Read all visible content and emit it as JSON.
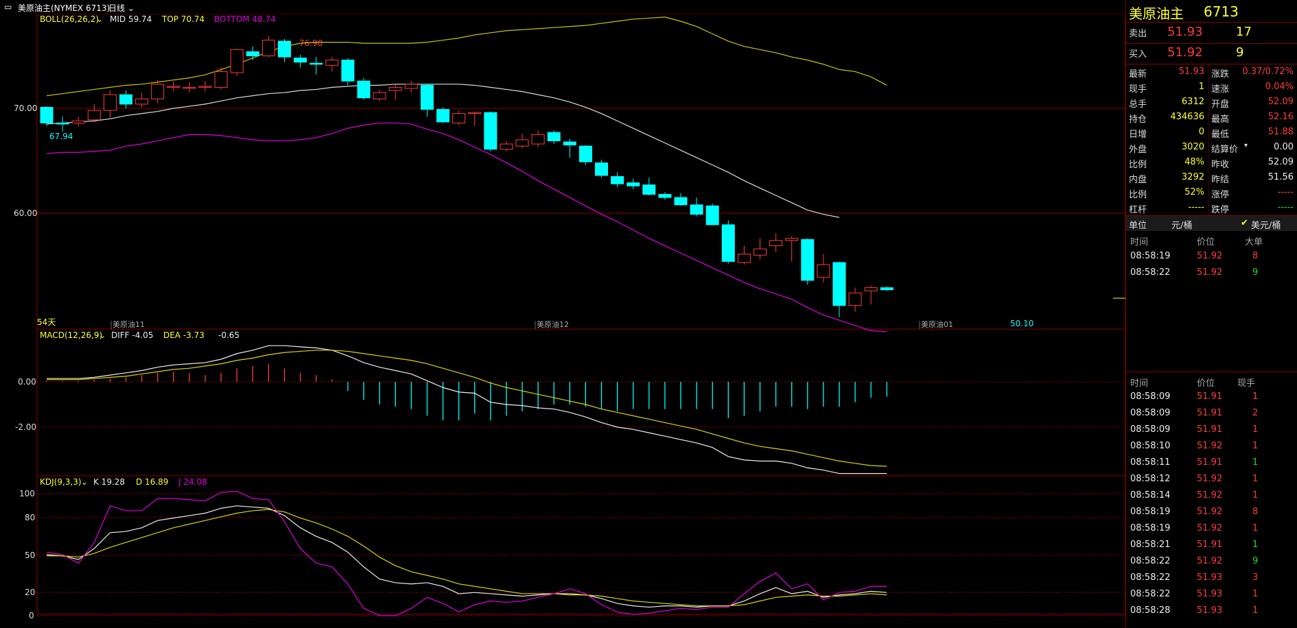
{
  "header": {
    "window_icon": "minimize-icon",
    "symbol_title": "美原油主(NYMEX 6713)",
    "period": "日线"
  },
  "indicators": {
    "boll": {
      "label": "BOLL(26,26,2)",
      "mid": "MID 59.74",
      "top": "TOP 70.74",
      "bottom": "BOTTOM 48.74"
    },
    "macd": {
      "label": "MACD(12,26,9)",
      "diff": "DIFF -4.05",
      "dea": "DEA -3.73",
      "macd": "-0.65"
    },
    "kdj": {
      "label": "KDJ(9,3,3)",
      "k": "K 19.28",
      "d": "D 16.89",
      "j": "J 24.08"
    }
  },
  "price_panel": {
    "y_ticks": [
      "70.00",
      "60.00"
    ],
    "high_label": "76.90",
    "low_label": "67.94",
    "last_low_label": "50.10",
    "days_label": "54天",
    "contract_labels": [
      "美原油11",
      "美原油12",
      "美原油01"
    ]
  },
  "macd_panel": {
    "y_ticks": [
      "0.00",
      "-2.00"
    ]
  },
  "kdj_panel": {
    "y_ticks": [
      "100",
      "80",
      "50",
      "20",
      "0"
    ]
  },
  "chart_data": {
    "type": "candlestick",
    "price_ylim": [
      48.0,
      80.0
    ],
    "candles": [
      [
        70.1,
        68.6,
        70.2,
        68.3
      ],
      [
        68.6,
        68.5,
        69.2,
        67.8
      ],
      [
        68.6,
        68.8,
        69.2,
        68.3
      ],
      [
        68.9,
        69.8,
        70.4,
        68.7
      ],
      [
        69.8,
        71.3,
        71.7,
        69.1
      ],
      [
        71.3,
        70.4,
        71.7,
        70.0
      ],
      [
        70.4,
        70.9,
        71.5,
        70.1
      ],
      [
        70.9,
        72.3,
        72.7,
        70.5
      ],
      [
        72.1,
        72.1,
        72.6,
        71.6
      ],
      [
        72.0,
        72.0,
        72.5,
        71.5
      ],
      [
        72.0,
        72.1,
        72.6,
        71.6
      ],
      [
        72.0,
        73.5,
        73.9,
        71.8
      ],
      [
        73.4,
        75.6,
        75.7,
        73.1
      ],
      [
        75.4,
        75.0,
        75.9,
        74.6
      ],
      [
        75.0,
        76.5,
        76.9,
        74.9
      ],
      [
        76.4,
        74.9,
        76.6,
        74.4
      ],
      [
        74.8,
        74.4,
        75.1,
        73.9
      ],
      [
        74.3,
        74.2,
        74.9,
        73.2
      ],
      [
        74.1,
        74.6,
        74.9,
        73.5
      ],
      [
        74.6,
        72.6,
        74.8,
        72.2
      ],
      [
        72.6,
        71.0,
        72.9,
        70.8
      ],
      [
        70.9,
        71.5,
        71.8,
        70.7
      ],
      [
        71.7,
        72.0,
        72.3,
        70.8
      ],
      [
        71.9,
        72.3,
        72.6,
        71.5
      ],
      [
        72.2,
        69.9,
        72.3,
        69.2
      ],
      [
        69.9,
        68.7,
        70.1,
        68.6
      ],
      [
        68.6,
        69.5,
        69.8,
        68.4
      ],
      [
        69.5,
        69.6,
        69.7,
        68.3
      ],
      [
        69.6,
        66.1,
        69.7,
        65.9
      ],
      [
        66.1,
        66.6,
        66.9,
        65.9
      ],
      [
        66.4,
        67.0,
        67.6,
        66.2
      ],
      [
        66.6,
        67.5,
        67.9,
        66.3
      ],
      [
        67.7,
        66.9,
        67.9,
        66.6
      ],
      [
        66.8,
        66.5,
        67.1,
        65.3
      ],
      [
        66.4,
        64.9,
        66.5,
        64.6
      ],
      [
        64.8,
        63.6,
        65.1,
        63.4
      ],
      [
        63.5,
        62.8,
        63.9,
        62.5
      ],
      [
        62.9,
        62.6,
        63.3,
        62.3
      ],
      [
        62.7,
        61.8,
        63.4,
        61.7
      ],
      [
        61.8,
        61.5,
        62.0,
        61.3
      ],
      [
        61.5,
        60.8,
        61.9,
        60.7
      ],
      [
        60.8,
        59.9,
        61.5,
        59.7
      ],
      [
        60.7,
        58.9,
        60.9,
        58.9
      ],
      [
        58.9,
        55.4,
        59.3,
        55.2
      ],
      [
        55.3,
        56.1,
        56.9,
        55.1
      ],
      [
        56.0,
        56.6,
        57.6,
        55.6
      ],
      [
        56.9,
        57.4,
        58.1,
        56.3
      ],
      [
        57.4,
        57.6,
        57.8,
        55.4
      ],
      [
        57.5,
        53.6,
        57.6,
        53.2
      ],
      [
        53.9,
        55.1,
        56.1,
        53.4
      ],
      [
        55.3,
        51.2,
        55.4,
        50.1
      ],
      [
        51.2,
        52.4,
        52.9,
        50.6
      ],
      [
        52.6,
        52.9,
        53.1,
        51.3
      ],
      [
        52.9,
        52.7,
        53.0,
        52.6
      ]
    ],
    "boll_top": [
      71.2,
      71.4,
      71.6,
      71.8,
      72.0,
      72.2,
      72.3,
      72.5,
      72.7,
      72.9,
      73.2,
      73.7,
      74.2,
      74.8,
      75.4,
      75.9,
      76.2,
      76.3,
      76.3,
      76.3,
      76.2,
      76.2,
      76.2,
      76.2,
      76.3,
      76.5,
      76.7,
      77.0,
      77.2,
      77.4,
      77.5,
      77.6,
      77.7,
      77.8,
      77.9,
      78.1,
      78.3,
      78.5,
      78.6,
      78.7,
      78.3,
      77.8,
      77.1,
      76.4,
      75.9,
      75.6,
      75.3,
      74.9,
      74.6,
      74.2,
      73.7,
      73.5,
      73.0,
      72.2
    ],
    "boll_mid": [
      68.5,
      68.6,
      68.7,
      68.8,
      69.0,
      69.3,
      69.5,
      69.7,
      70.0,
      70.2,
      70.4,
      70.7,
      71.0,
      71.2,
      71.4,
      71.5,
      71.7,
      71.8,
      72.0,
      72.1,
      72.2,
      72.2,
      72.3,
      72.3,
      72.3,
      72.3,
      72.3,
      72.2,
      72.0,
      71.8,
      71.6,
      71.3,
      71.0,
      70.6,
      70.1,
      69.5,
      68.8,
      68.1,
      67.4,
      66.7,
      66.0,
      65.3,
      64.6,
      63.9,
      63.1,
      62.4,
      61.7,
      61.0,
      60.3,
      59.9,
      59.6
    ],
    "boll_bot": [
      65.7,
      65.8,
      65.8,
      65.9,
      66.0,
      66.4,
      66.6,
      66.9,
      67.2,
      67.5,
      67.5,
      67.4,
      67.2,
      67.0,
      66.9,
      66.9,
      67.0,
      67.2,
      67.6,
      68.1,
      68.4,
      68.6,
      68.6,
      68.5,
      68.0,
      67.6,
      67.0,
      66.3,
      65.6,
      64.8,
      64.0,
      63.1,
      62.3,
      61.5,
      60.7,
      59.9,
      59.2,
      58.4,
      57.6,
      56.9,
      56.2,
      55.5,
      54.8,
      54.1,
      53.4,
      52.8,
      52.3,
      51.8,
      51.0,
      50.3,
      49.8,
      49.3,
      48.8,
      48.7
    ],
    "macd_ylim": [
      -4.3,
      1.8
    ],
    "macd_diff": [
      0.15,
      0.15,
      0.15,
      0.2,
      0.3,
      0.4,
      0.5,
      0.65,
      0.75,
      0.8,
      0.85,
      1.0,
      1.25,
      1.4,
      1.6,
      1.6,
      1.55,
      1.5,
      1.4,
      1.15,
      0.85,
      0.65,
      0.5,
      0.35,
      0.05,
      -0.25,
      -0.45,
      -0.5,
      -0.9,
      -1.0,
      -1.05,
      -1.15,
      -1.2,
      -1.35,
      -1.55,
      -1.8,
      -2.0,
      -2.1,
      -2.25,
      -2.4,
      -2.55,
      -2.7,
      -2.9,
      -3.3,
      -3.45,
      -3.5,
      -3.5,
      -3.6,
      -3.8,
      -3.9,
      -4.05,
      -4.05,
      -4.05,
      -4.05
    ],
    "macd_dea": [
      0.1,
      0.1,
      0.1,
      0.15,
      0.2,
      0.25,
      0.35,
      0.45,
      0.55,
      0.6,
      0.7,
      0.8,
      0.95,
      1.05,
      1.2,
      1.3,
      1.35,
      1.4,
      1.4,
      1.35,
      1.25,
      1.15,
      1.05,
      0.95,
      0.8,
      0.6,
      0.4,
      0.2,
      -0.05,
      -0.25,
      -0.4,
      -0.55,
      -0.7,
      -0.85,
      -1.0,
      -1.2,
      -1.35,
      -1.5,
      -1.65,
      -1.8,
      -1.95,
      -2.1,
      -2.3,
      -2.5,
      -2.7,
      -2.85,
      -2.95,
      -3.05,
      -3.2,
      -3.35,
      -3.5,
      -3.6,
      -3.7,
      -3.73
    ],
    "macd_hist": [
      0.05,
      0.05,
      0.05,
      0.1,
      0.15,
      0.2,
      0.3,
      0.4,
      0.45,
      0.4,
      0.3,
      0.4,
      0.6,
      0.7,
      0.8,
      0.6,
      0.4,
      0.3,
      0.1,
      -0.4,
      -0.8,
      -1.0,
      -1.1,
      -1.2,
      -1.5,
      -1.7,
      -1.7,
      -1.4,
      -1.7,
      -1.5,
      -1.3,
      -1.2,
      -1.0,
      -1.0,
      -1.1,
      -1.2,
      -1.3,
      -1.2,
      -1.2,
      -1.2,
      -1.2,
      -1.2,
      -1.2,
      -1.6,
      -1.5,
      -1.3,
      -1.1,
      -1.1,
      -1.2,
      -1.1,
      -1.1,
      -0.9,
      -0.7,
      -0.65
    ],
    "kdj_ylim": [
      -5,
      105
    ],
    "kdj_k": [
      50,
      49,
      46,
      55,
      68,
      69,
      72,
      78,
      80,
      82,
      84,
      88,
      90,
      89,
      88,
      82,
      72,
      65,
      60,
      52,
      40,
      30,
      27,
      26,
      27,
      24,
      18,
      19,
      18,
      17,
      16,
      17,
      18,
      18,
      17,
      14,
      10,
      8,
      7,
      8,
      8,
      7,
      8,
      8,
      12,
      18,
      23,
      18,
      20,
      15,
      17,
      18,
      20,
      19
    ],
    "kdj_d": [
      49,
      49,
      48,
      51,
      56,
      60,
      64,
      68,
      72,
      75,
      78,
      81,
      84,
      86,
      87,
      85,
      80,
      76,
      71,
      65,
      57,
      48,
      41,
      36,
      33,
      30,
      26,
      24,
      22,
      20,
      18,
      18,
      18,
      17,
      17,
      16,
      14,
      12,
      11,
      10,
      9,
      8,
      8,
      8,
      9,
      12,
      15,
      16,
      17,
      16,
      16,
      17,
      18,
      17
    ],
    "kdj_j": [
      52,
      50,
      43,
      60,
      90,
      86,
      86,
      96,
      96,
      95,
      94,
      101,
      102,
      96,
      95,
      77,
      55,
      43,
      40,
      26,
      6,
      0,
      0,
      6,
      15,
      10,
      3,
      9,
      12,
      11,
      12,
      15,
      18,
      22,
      18,
      9,
      3,
      1,
      2,
      4,
      6,
      5,
      7,
      7,
      18,
      28,
      35,
      22,
      26,
      13,
      19,
      20,
      24,
      24
    ]
  },
  "right_panel": {
    "title": "美原油主",
    "code": "6713",
    "sell_label": "卖出",
    "sell_price": "51.93",
    "sell_vol": "17",
    "buy_label": "买入",
    "buy_price": "51.92",
    "buy_vol": "9",
    "stats": [
      {
        "l1": "最新",
        "v1": "51.93",
        "c1": "red",
        "l2": "涨跌",
        "v2": "0.37/0.72%",
        "c2": "red"
      },
      {
        "l1": "现手",
        "v1": "1",
        "c1": "yellow",
        "l2": "速涨",
        "v2": "0.04%",
        "c2": "red"
      },
      {
        "l1": "总手",
        "v1": "6312",
        "c1": "yellow",
        "l2": "开盘",
        "v2": "52.09",
        "c2": "red"
      },
      {
        "l1": "持仓",
        "v1": "434636",
        "c1": "yellow",
        "l2": "最高",
        "v2": "52.16",
        "c2": "red"
      },
      {
        "l1": "日增",
        "v1": "0",
        "c1": "yellow",
        "l2": "最低",
        "v2": "51.88",
        "c2": "red"
      },
      {
        "l1": "外盘",
        "v1": "3020",
        "c1": "yellow",
        "l2": "结算价",
        "v2": "0.00",
        "c2": "white"
      },
      {
        "l1": "比例",
        "v1": "48%",
        "c1": "yellow",
        "l2": "昨收",
        "v2": "52.09",
        "c2": "white"
      },
      {
        "l1": "内盘",
        "v1": "3292",
        "c1": "yellow",
        "l2": "昨结",
        "v2": "51.56",
        "c2": "white"
      },
      {
        "l1": "比例",
        "v1": "52%",
        "c1": "yellow",
        "l2": "涨停",
        "v2": "-----",
        "c2": "red"
      },
      {
        "l1": "杠杆",
        "v1": "-----",
        "c1": "yellow",
        "l2": "跌停",
        "v2": "-----",
        "c2": "green"
      }
    ],
    "unit_label": "单位",
    "unit_cny": "元/桶",
    "unit_usd": "美元/桶",
    "bigorder_headers": [
      "时间",
      "价位",
      "大单"
    ],
    "bigorders": [
      {
        "t": "08:58:19",
        "p": "51.92",
        "v": "8",
        "vc": "red"
      },
      {
        "t": "08:58:22",
        "p": "51.92",
        "v": "9",
        "vc": "green"
      }
    ],
    "tick_headers": [
      "时间",
      "价位",
      "现手"
    ],
    "ticks": [
      {
        "t": "08:58:09",
        "p": "51.91",
        "v": "1",
        "vc": "red"
      },
      {
        "t": "08:58:09",
        "p": "51.91",
        "v": "2",
        "vc": "red"
      },
      {
        "t": "08:58:09",
        "p": "51.91",
        "v": "1",
        "vc": "red"
      },
      {
        "t": "08:58:10",
        "p": "51.92",
        "v": "1",
        "vc": "red"
      },
      {
        "t": "08:58:11",
        "p": "51.91",
        "v": "1",
        "vc": "green"
      },
      {
        "t": "08:58:12",
        "p": "51.92",
        "v": "1",
        "vc": "red"
      },
      {
        "t": "08:58:14",
        "p": "51.92",
        "v": "1",
        "vc": "red"
      },
      {
        "t": "08:58:19",
        "p": "51.92",
        "v": "8",
        "vc": "red"
      },
      {
        "t": "08:58:19",
        "p": "51.92",
        "v": "1",
        "vc": "red"
      },
      {
        "t": "08:58:21",
        "p": "51.91",
        "v": "1",
        "vc": "green"
      },
      {
        "t": "08:58:22",
        "p": "51.92",
        "v": "9",
        "vc": "green"
      },
      {
        "t": "08:58:22",
        "p": "51.93",
        "v": "3",
        "vc": "red"
      },
      {
        "t": "08:58:22",
        "p": "51.93",
        "v": "1",
        "vc": "red"
      },
      {
        "t": "08:58:28",
        "p": "51.93",
        "v": "1",
        "vc": "red"
      }
    ]
  },
  "colors": {
    "up": "#ff3b3b",
    "down": "#00ffff",
    "boll_top": "#c8c800",
    "boll_mid": "#dddddd",
    "boll_bot": "#e000e0",
    "grid": "#8b0000"
  }
}
